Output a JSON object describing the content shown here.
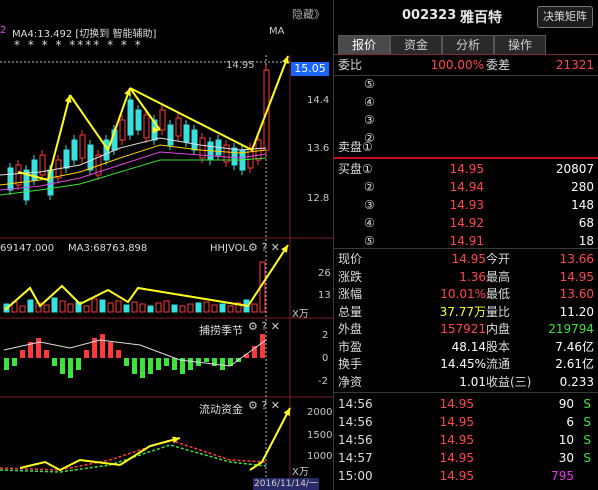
{
  "header": {
    "code": "002323",
    "name": "雅百特",
    "decide_button": "决策矩阵",
    "hide_button": "隐藏》"
  },
  "tabs": [
    "报价",
    "资金",
    "分析",
    "操作"
  ],
  "order_book": {
    "weibi_label": "委比",
    "weibi_value": "100.00%",
    "weicha_label": "委差",
    "weicha_value": "21321",
    "sell_label": "卖盘①",
    "sell_levels": [
      "⑤",
      "④",
      "③",
      "②"
    ],
    "buy_label": "买盘①",
    "buy_levels": [
      {
        "level": "买盘①",
        "price": "14.95",
        "vol": "20807"
      },
      {
        "level": "②",
        "price": "14.94",
        "vol": "280"
      },
      {
        "level": "③",
        "price": "14.93",
        "vol": "148"
      },
      {
        "level": "④",
        "price": "14.92",
        "vol": "68"
      },
      {
        "level": "⑤",
        "price": "14.91",
        "vol": "18"
      }
    ]
  },
  "quote": [
    {
      "l1": "现价",
      "v1": "14.95",
      "c1": "red",
      "l2": "今开",
      "v2": "13.66",
      "c2": "red"
    },
    {
      "l1": "涨跌",
      "v1": "1.36",
      "c1": "red",
      "l2": "最高",
      "v2": "14.95",
      "c2": "red"
    },
    {
      "l1": "涨幅",
      "v1": "10.01%",
      "c1": "red",
      "l2": "最低",
      "v2": "13.60",
      "c2": "red"
    },
    {
      "l1": "总量",
      "v1": "37.77万",
      "c1": "yellow",
      "l2": "量比",
      "v2": "11.20",
      "c2": "white"
    },
    {
      "l1": "外盘",
      "v1": "157921",
      "c1": "red",
      "l2": "内盘",
      "v2": "219794",
      "c2": "green"
    },
    {
      "l1": "市盈",
      "v1": "48.14",
      "c1": "white",
      "l2": "股本",
      "v2": "7.46亿",
      "c2": "white"
    },
    {
      "l1": "换手",
      "v1": "14.45%",
      "c1": "white",
      "l2": "流通",
      "v2": "2.61亿",
      "c2": "white"
    },
    {
      "l1": "净资",
      "v1": "1.01",
      "c1": "white",
      "l2": "收益(三)",
      "v2": "0.233",
      "c2": "white"
    }
  ],
  "ticks": [
    {
      "time": "14:56",
      "price": "14.95",
      "vol": "90",
      "side": "S"
    },
    {
      "time": "14:56",
      "price": "14.95",
      "vol": "6",
      "side": "S"
    },
    {
      "time": "14:56",
      "price": "14.95",
      "vol": "10",
      "side": "S"
    },
    {
      "time": "14:57",
      "price": "14.95",
      "vol": "30",
      "side": "S"
    },
    {
      "time": "15:00",
      "price": "14.95",
      "vol": "795",
      "side": ""
    }
  ],
  "chart": {
    "top_label": "MA4:13.492 [切换到 智能辅助]",
    "top_prefix": "2",
    "ma_label": "MA",
    "stars": "* * * * **** * * *",
    "price_ticks": [
      "14.95",
      "14.4",
      "13.6",
      "12.8"
    ],
    "current_price": "15.05",
    "vol_label_left": "69147.000",
    "vol_label_ma3": "MA3:68763.898",
    "vol_label_name": "HHJVOL",
    "vol_ticks": [
      "26",
      "13"
    ],
    "vol_unit": "X万",
    "season_label": "捕捞季节",
    "season_ticks": [
      "2",
      "0",
      "-2"
    ],
    "flow_label": "流动资金",
    "flow_ticks": [
      "2000",
      "1500",
      "1000"
    ],
    "flow_unit": "X万",
    "date": "2016/11/14/一"
  }
}
